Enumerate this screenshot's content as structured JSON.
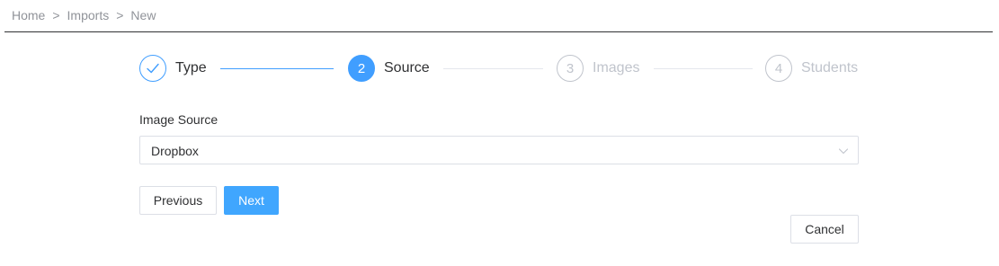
{
  "breadcrumb": {
    "items": [
      "Home",
      "Imports",
      "New"
    ],
    "separator": ">"
  },
  "steps": [
    {
      "label": "Type",
      "status": "done",
      "number": ""
    },
    {
      "label": "Source",
      "status": "active",
      "number": "2"
    },
    {
      "label": "Images",
      "status": "wait",
      "number": "3"
    },
    {
      "label": "Students",
      "status": "wait",
      "number": "4"
    }
  ],
  "form": {
    "label": "Image Source",
    "selected": "Dropbox"
  },
  "buttons": {
    "previous": "Previous",
    "next": "Next",
    "cancel": "Cancel"
  },
  "colors": {
    "primary": "#409eff",
    "next_button": "#40a6fe",
    "muted": "#c0c4cc"
  },
  "icons": {
    "step_done": "checkmark-icon",
    "select": "chevron-down-icon"
  }
}
